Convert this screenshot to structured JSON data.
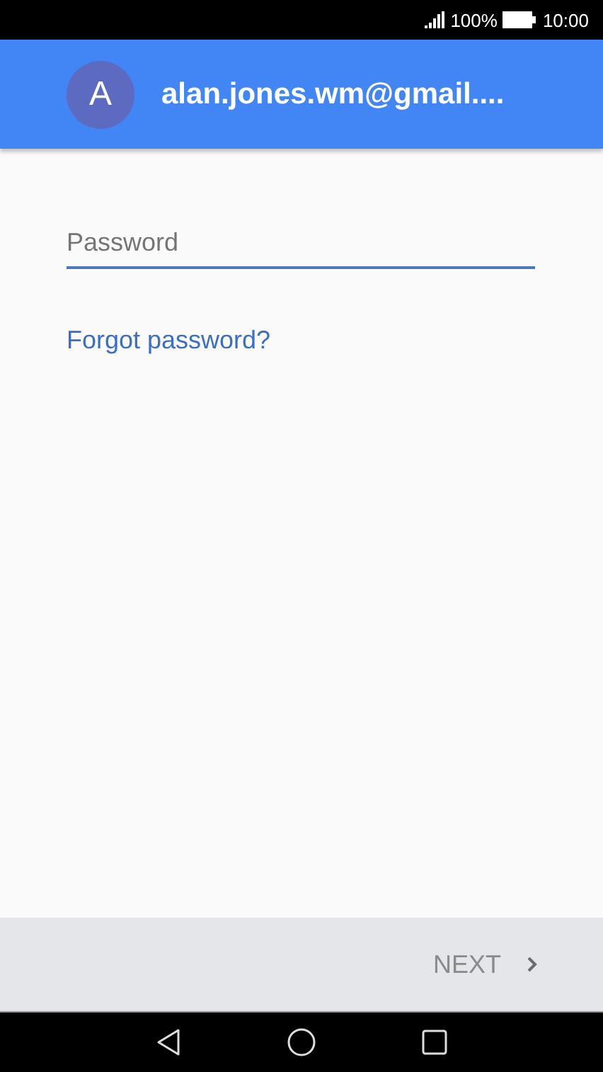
{
  "status_bar": {
    "battery": "100%",
    "time": "10:00"
  },
  "header": {
    "avatar_letter": "A",
    "account": "alan.jones.wm@gmail...."
  },
  "password": {
    "placeholder": "Password"
  },
  "forgot_link": "Forgot password?",
  "footer": {
    "next_label": "NEXT"
  }
}
